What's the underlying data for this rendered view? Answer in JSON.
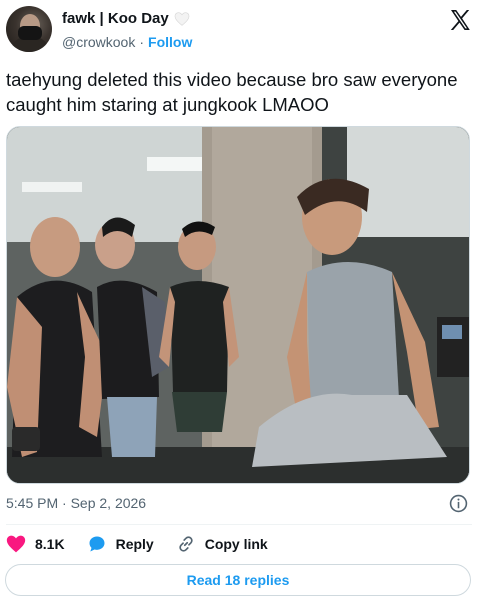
{
  "author": {
    "display_name": "fawk | Koo Day",
    "handle": "@crowkook",
    "separator": "·",
    "follow_label": "Follow"
  },
  "tweet": {
    "text": "taehyung deleted this video because bro saw everyone caught him staring at jungkook LMAOO",
    "timestamp": "5:45 PM · Sep 2, 2026"
  },
  "actions": {
    "likes": "8.1K",
    "reply_label": "Reply",
    "copy_link_label": "Copy link"
  },
  "replies_button": "Read 18 replies",
  "icons": [
    "white-heart-icon",
    "x-logo-icon",
    "info-icon",
    "heart-icon",
    "reply-bubble-icon",
    "link-icon"
  ],
  "colors": {
    "accent": "#1d9bf0",
    "like": "#f91880",
    "secondary_text": "#536471"
  }
}
